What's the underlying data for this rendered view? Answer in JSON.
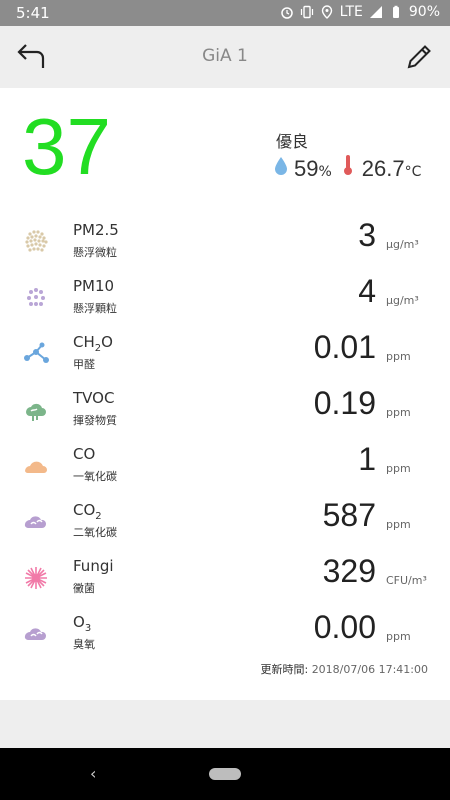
{
  "status_bar": {
    "time": "5:41",
    "network": "LTE",
    "battery": "90%",
    "icons": [
      "alarm-icon",
      "vibrate-icon",
      "location-icon",
      "signal-icon",
      "battery-icon"
    ]
  },
  "header": {
    "title": "GiA 1",
    "back_icon": "back-arrow-icon",
    "edit_icon": "pencil-icon"
  },
  "summary": {
    "aqi": "37",
    "aqi_color": "#22dd22",
    "quality": "優良",
    "humidity": "59",
    "humidity_unit": "%",
    "temperature": "26.7",
    "temperature_unit": "°C"
  },
  "readings": [
    {
      "name": "PM2.5",
      "name_sub": "",
      "subtitle": "懸浮微粒",
      "value": "3",
      "unit": "μg/m³",
      "icon": "pm25-dots-icon",
      "color": "#d9c9a8"
    },
    {
      "name": "PM10",
      "name_sub": "",
      "subtitle": "懸浮顆粒",
      "value": "4",
      "unit": "μg/m³",
      "icon": "pm10-dots-icon",
      "color": "#b9a6d6"
    },
    {
      "name": "CH",
      "name_sub": "2",
      "name_tail": "O",
      "subtitle": "甲醛",
      "value": "0.01",
      "unit": "ppm",
      "icon": "molecule-icon",
      "color": "#6aa6dd"
    },
    {
      "name": "TVOC",
      "name_sub": "",
      "subtitle": "揮發物質",
      "value": "0.19",
      "unit": "ppm",
      "icon": "tvoc-cloud-icon",
      "color": "#7cb58a"
    },
    {
      "name": "CO",
      "name_sub": "",
      "subtitle": "一氧化碳",
      "value": "1",
      "unit": "ppm",
      "icon": "co-cloud-icon",
      "color": "#f3b98a"
    },
    {
      "name": "CO",
      "name_sub": "2",
      "subtitle": "二氧化碳",
      "value": "587",
      "unit": "ppm",
      "icon": "co2-cloud-icon",
      "color": "#b79fd0"
    },
    {
      "name": "Fungi",
      "name_sub": "",
      "subtitle": "黴菌",
      "value": "329",
      "unit": "CFU/m³",
      "icon": "fungi-spore-icon",
      "color": "#f17aa8"
    },
    {
      "name": "O",
      "name_sub": "3",
      "subtitle": "臭氧",
      "value": "0.00",
      "unit": "ppm",
      "icon": "ozone-cloud-icon",
      "color": "#b79fd0"
    }
  ],
  "updated": {
    "label": "更新時間:",
    "timestamp": "2018/07/06 17:41:00"
  },
  "nav": {
    "back": "‹"
  }
}
